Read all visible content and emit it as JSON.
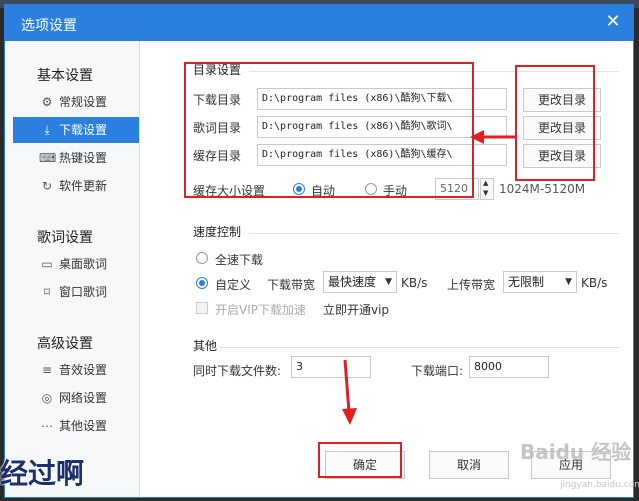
{
  "dialog": {
    "title": "选项设置",
    "close_glyph": "✕"
  },
  "sidebar": {
    "sections": [
      {
        "title": "基本设置",
        "items": [
          {
            "icon": "gear-icon",
            "glyph": "⚙",
            "label": "常规设置",
            "active": false
          },
          {
            "icon": "download-icon",
            "glyph": "⤓",
            "label": "下载设置",
            "active": true
          },
          {
            "icon": "keyboard-icon",
            "glyph": "⌨",
            "label": "热键设置",
            "active": false
          },
          {
            "icon": "refresh-icon",
            "glyph": "↻",
            "label": "软件更新",
            "active": false
          }
        ]
      },
      {
        "title": "歌词设置",
        "items": [
          {
            "icon": "desktop-lyrics-icon",
            "glyph": "▭",
            "label": "桌面歌词",
            "active": false
          },
          {
            "icon": "window-lyrics-icon",
            "glyph": "⌑",
            "label": "窗口歌词",
            "active": false
          }
        ]
      },
      {
        "title": "高级设置",
        "items": [
          {
            "icon": "equalizer-icon",
            "glyph": "≡",
            "label": "音效设置",
            "active": false
          },
          {
            "icon": "network-icon",
            "glyph": "◎",
            "label": "网络设置",
            "active": false
          },
          {
            "icon": "more-icon",
            "glyph": "⋯",
            "label": "其他设置",
            "active": false
          }
        ]
      }
    ]
  },
  "directory": {
    "title": "目录设置",
    "rows": [
      {
        "label": "下载目录",
        "path": "D:\\program files (x86)\\酷狗\\下载\\",
        "button": "更改目录"
      },
      {
        "label": "歌词目录",
        "path": "D:\\program files (x86)\\酷狗\\歌词\\",
        "button": "更改目录"
      },
      {
        "label": "缓存目录",
        "path": "D:\\program files (x86)\\酷狗\\缓存\\",
        "button": "更改目录"
      }
    ],
    "cache_size_label": "缓存大小设置",
    "auto_label": "自动",
    "manual_label": "手动",
    "cache_value": "5120",
    "cache_range": "1024M-5120M",
    "spin_up": "▲",
    "spin_down": "▼"
  },
  "speed": {
    "title": "速度控制",
    "full_speed_label": "全速下载",
    "custom_label": "自定义",
    "download_bw_label": "下载带宽",
    "download_bw_value": "最快速度",
    "upload_bw_label": "上传带宽",
    "upload_bw_value": "无限制",
    "unit": "KB/s",
    "vip_label": "开启VIP下载加速",
    "vip_link": "立即开通vip",
    "arrow_glyph": "▼"
  },
  "other": {
    "title": "其他",
    "simultaneous_label": "同时下载文件数:",
    "simultaneous_value": "3",
    "port_label": "下载端口:",
    "port_value": "8000"
  },
  "buttons": {
    "ok": "确定",
    "cancel": "取消",
    "apply": "应用"
  },
  "overlay": {
    "caption": "经过啊",
    "watermark": "Baidu 经验",
    "watermark_sub": "jingyan.baidu.com"
  },
  "colors": {
    "accent": "#2b7fde",
    "annotation": "#e02020"
  }
}
